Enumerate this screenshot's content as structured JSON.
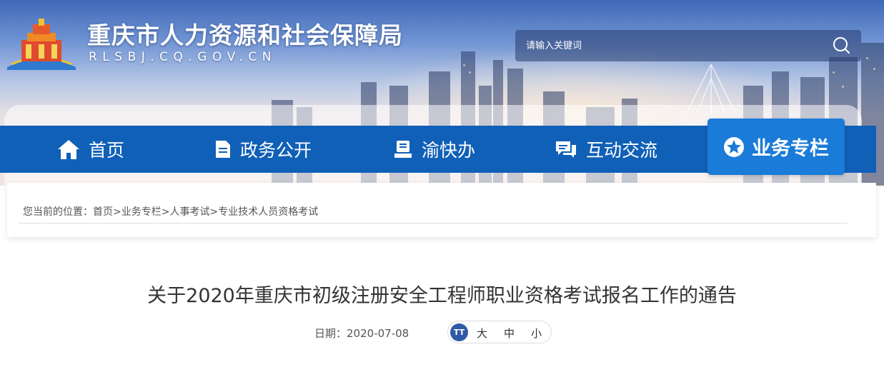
{
  "header": {
    "title": "重庆市人力资源和社会保障局",
    "domain": "RLSBJ.CQ.GOV.CN"
  },
  "search": {
    "placeholder": "请输入关键词"
  },
  "nav": {
    "items": [
      {
        "label": "首页",
        "icon": "home-icon"
      },
      {
        "label": "政务公开",
        "icon": "document-icon"
      },
      {
        "label": "渝快办",
        "icon": "service-icon"
      },
      {
        "label": "互动交流",
        "icon": "chat-icon"
      }
    ],
    "special": {
      "label": "业务专栏",
      "icon": "star-icon"
    }
  },
  "breadcrumb": {
    "prefix": "您当前的位置：",
    "items": [
      "首页",
      "业务专栏",
      "人事考试",
      "专业技术人员资格考试"
    ],
    "separator": ">"
  },
  "article": {
    "title": "关于2020年重庆市初级注册安全工程师职业资格考试报名工作的通告",
    "date_label": "日期：",
    "date": "2020-07-08",
    "font_sizes": {
      "icon_text": "TT",
      "large": "大",
      "medium": "中",
      "small": "小"
    }
  },
  "colors": {
    "nav_bg": "#1060b7",
    "nav_special_bg": "#1a7bd8",
    "text_dark": "#333333"
  }
}
